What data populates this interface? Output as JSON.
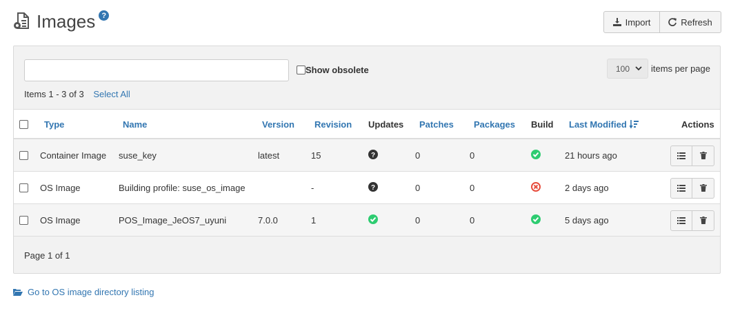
{
  "header": {
    "title": "Images",
    "help_glyph": "?",
    "import_label": "Import",
    "refresh_label": "Refresh"
  },
  "toolbar": {
    "search_value": "",
    "show_obsolete_label": "Show obsolete",
    "per_page_value": "100",
    "per_page_label": "items per page",
    "items_count": "Items 1 - 3 of 3",
    "select_all": "Select All"
  },
  "table": {
    "columns": {
      "type": "Type",
      "name": "Name",
      "version": "Version",
      "revision": "Revision",
      "updates": "Updates",
      "patches": "Patches",
      "packages": "Packages",
      "build": "Build",
      "last_modified": "Last Modified",
      "actions": "Actions"
    },
    "rows": [
      {
        "type": "Container Image",
        "name": "suse_key",
        "version": "latest",
        "revision": "15",
        "updates": "unknown",
        "patches": "0",
        "packages": "0",
        "build": "success",
        "modified": "21 hours ago"
      },
      {
        "type": "OS Image",
        "name": "Building profile: suse_os_image",
        "version": "",
        "revision": "-",
        "updates": "unknown",
        "patches": "0",
        "packages": "0",
        "build": "failed",
        "modified": "2 days ago"
      },
      {
        "type": "OS Image",
        "name": "POS_Image_JeOS7_uyuni",
        "version": "7.0.0",
        "revision": "1",
        "updates": "ok",
        "patches": "0",
        "packages": "0",
        "build": "success",
        "modified": "5 days ago"
      }
    ]
  },
  "pager": {
    "text": "Page 1 of 1"
  },
  "footer": {
    "link": "Go to OS image directory listing"
  },
  "colors": {
    "link": "#3276b1",
    "success": "#2ecc71",
    "error": "#e74c3c",
    "unknown": "#333333"
  }
}
